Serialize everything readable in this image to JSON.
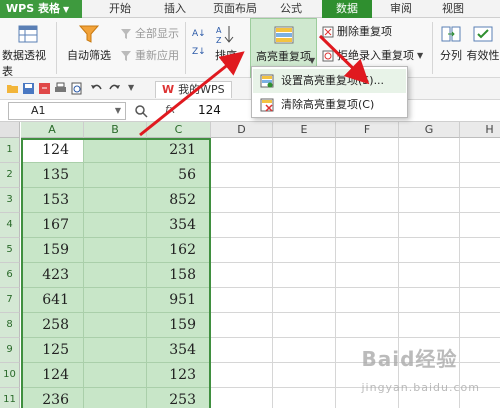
{
  "app": {
    "title": "WPS 表格"
  },
  "tabs": [
    {
      "label": "开始"
    },
    {
      "label": "插入"
    },
    {
      "label": "页面布局"
    },
    {
      "label": "公式"
    },
    {
      "label": "数据"
    },
    {
      "label": "审阅"
    },
    {
      "label": "视图"
    }
  ],
  "active_tab": "数据",
  "ribbon": {
    "pivot_label": "数据透视表",
    "autofilter_label": "自动筛选",
    "show_all_label": "全部显示",
    "reapply_label": "重新应用",
    "sort_label": "排序",
    "highlight_dup_label": "高亮重复项",
    "delete_dup_label": "删除重复项",
    "reject_dup_label": "拒绝录入重复项",
    "split_label": "分列",
    "validity_label": "有效性"
  },
  "menu": {
    "items": [
      {
        "label": "设置高亮重复项(S)..."
      },
      {
        "label": "清除高亮重复项(C)"
      }
    ]
  },
  "doc_tab": {
    "label": "我的WPS"
  },
  "formula_bar": {
    "cell_ref": "A1",
    "fx": "fx",
    "value": "124"
  },
  "columns": [
    "A",
    "B",
    "C",
    "D",
    "E",
    "F",
    "G",
    "H"
  ],
  "rows": [
    "1",
    "2",
    "3",
    "4",
    "5",
    "6",
    "7",
    "8",
    "9",
    "10",
    "11"
  ],
  "data": {
    "A": [
      "124",
      "135",
      "153",
      "167",
      "159",
      "423",
      "641",
      "258",
      "125",
      "124",
      "236"
    ],
    "C": [
      "231",
      "56",
      "852",
      "354",
      "162",
      "158",
      "951",
      "159",
      "354",
      "123",
      "253"
    ]
  },
  "watermark": {
    "text": "Baid经验",
    "sub": "jingyan.baidu.com"
  },
  "colors": {
    "accent": "#2f8f2f",
    "selection": "#c8e6c8"
  }
}
